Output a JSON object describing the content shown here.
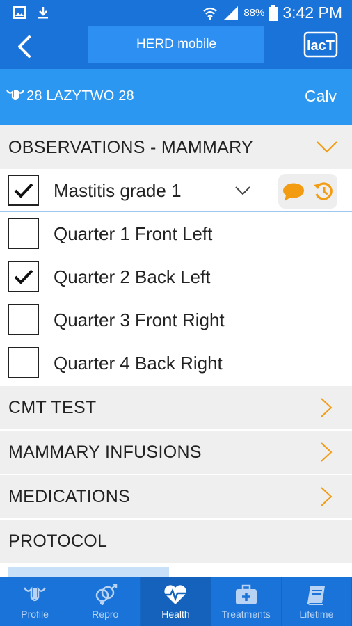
{
  "status_bar": {
    "battery": "88%",
    "time": "3:42 PM"
  },
  "app_bar": {
    "title": "HERD mobile",
    "lact_label": "lacT"
  },
  "animal": {
    "name": "28 LAZYTWO 28",
    "action": "Calv"
  },
  "observations": {
    "header": "OBSERVATIONS - MAMMARY",
    "grade": {
      "label": "Mastitis grade 1",
      "checked": true
    },
    "quarters": [
      {
        "label": "Quarter 1 Front Left",
        "checked": false
      },
      {
        "label": "Quarter 2 Back Left",
        "checked": true
      },
      {
        "label": "Quarter 3 Front Right",
        "checked": false
      },
      {
        "label": "Quarter 4 Back Right",
        "checked": false
      }
    ]
  },
  "sections": [
    {
      "label": "CMT TEST",
      "has_chevron": true
    },
    {
      "label": "MAMMARY INFUSIONS",
      "has_chevron": true
    },
    {
      "label": "MEDICATIONS",
      "has_chevron": true
    },
    {
      "label": "PROTOCOL",
      "has_chevron": false
    }
  ],
  "bottom_nav": [
    {
      "label": "Profile",
      "icon": "uterus-icon",
      "active": false
    },
    {
      "label": "Repro",
      "icon": "gender-icon",
      "active": false
    },
    {
      "label": "Health",
      "icon": "heartbeat-icon",
      "active": true
    },
    {
      "label": "Treatments",
      "icon": "first-aid-kit-icon",
      "active": false
    },
    {
      "label": "Lifetime",
      "icon": "book-icon",
      "active": false
    }
  ],
  "colors": {
    "primary": "#1a73d9",
    "secondary": "#2c97f0",
    "accent_orange": "#f39c12",
    "section_bg": "#efefef"
  }
}
